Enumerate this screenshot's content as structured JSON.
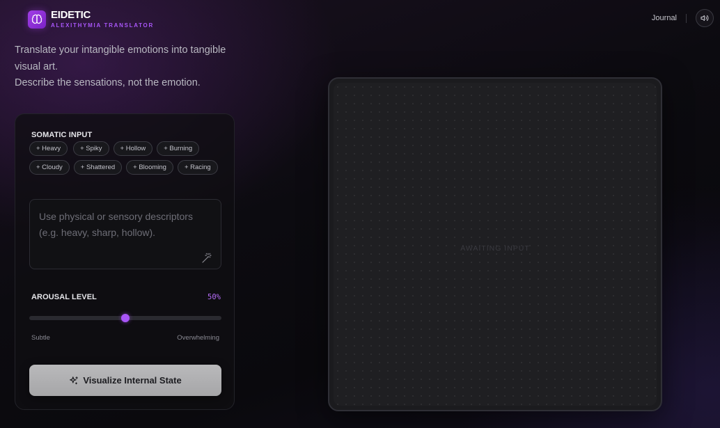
{
  "app": {
    "title": "EIDETIC",
    "subtitle": "ALEXITHYMIA TRANSLATOR",
    "logo_icon": "brain-icon",
    "accent_color": "#a855f7"
  },
  "nav": {
    "journal_label": "Journal",
    "sound_icon": "speaker-icon"
  },
  "intro": {
    "line1": "Translate your intangible emotions into tangible visual art.",
    "line2": "Describe the sensations, not the emotion."
  },
  "somatic": {
    "label": "SOMATIC INPUT",
    "chips": [
      "+ Heavy",
      "+ Spiky",
      "+ Hollow",
      "+ Burning",
      "+ Cloudy",
      "+ Shattered",
      "+ Blooming",
      "+ Racing"
    ],
    "input_value": "",
    "input_placeholder": "Use physical or sensory descriptors (e.g. heavy, sharp, hollow).",
    "magic_icon": "magic-wand-icon"
  },
  "arousal": {
    "label": "AROUSAL LEVEL",
    "value_text": "50%",
    "value": 50,
    "min_label": "Subtle",
    "max_label": "Overwhelming"
  },
  "action": {
    "label": "Visualize Internal State",
    "icon": "sparkles-icon"
  },
  "canvas": {
    "status": "AWAITING INPUT"
  }
}
